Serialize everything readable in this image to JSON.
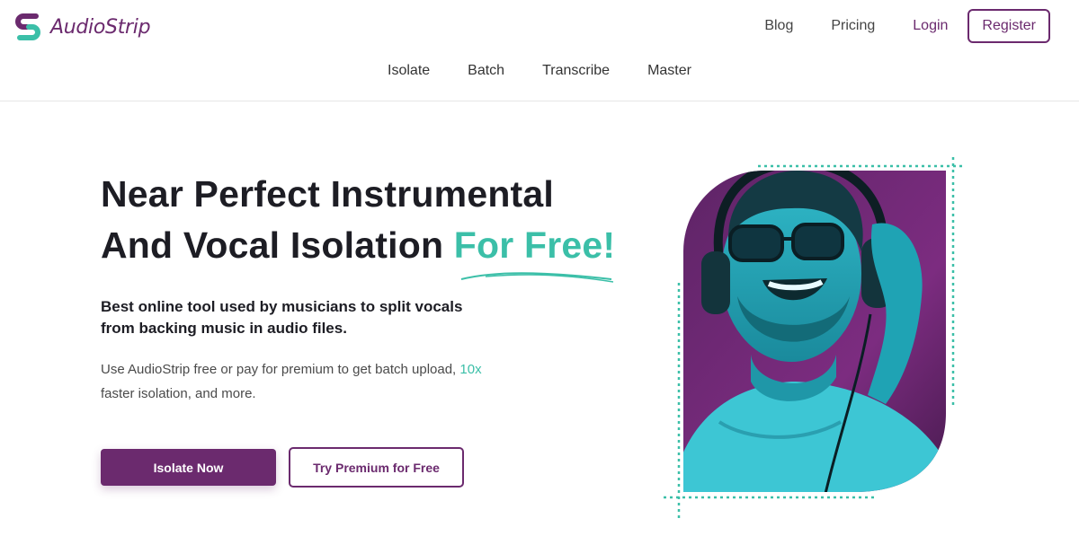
{
  "brand": {
    "name": "AudioStrip",
    "primary_color": "#6b2a6e",
    "accent_color": "#3bbfa8"
  },
  "top_nav": {
    "blog": "Blog",
    "pricing": "Pricing",
    "login": "Login",
    "register": "Register"
  },
  "sub_nav": [
    "Isolate",
    "Batch",
    "Transcribe",
    "Master"
  ],
  "hero": {
    "title_line1": "Near Perfect Instrumental",
    "title_line2_prefix": "And Vocal Isolation",
    "title_accent": "For Free!",
    "subtitle": "Best online tool used by musicians to split vocals from backing music in audio files.",
    "description_before": "Use AudioStrip free or pay for premium to get batch upload,",
    "description_accent": "10x",
    "description_after": "faster isolation, and more.",
    "primary_button": "Isolate Now",
    "secondary_button": "Try Premium for Free"
  },
  "icons": {
    "logo": "audiostrip-s-logo-icon",
    "hero_image": "man-with-headphones-image"
  }
}
